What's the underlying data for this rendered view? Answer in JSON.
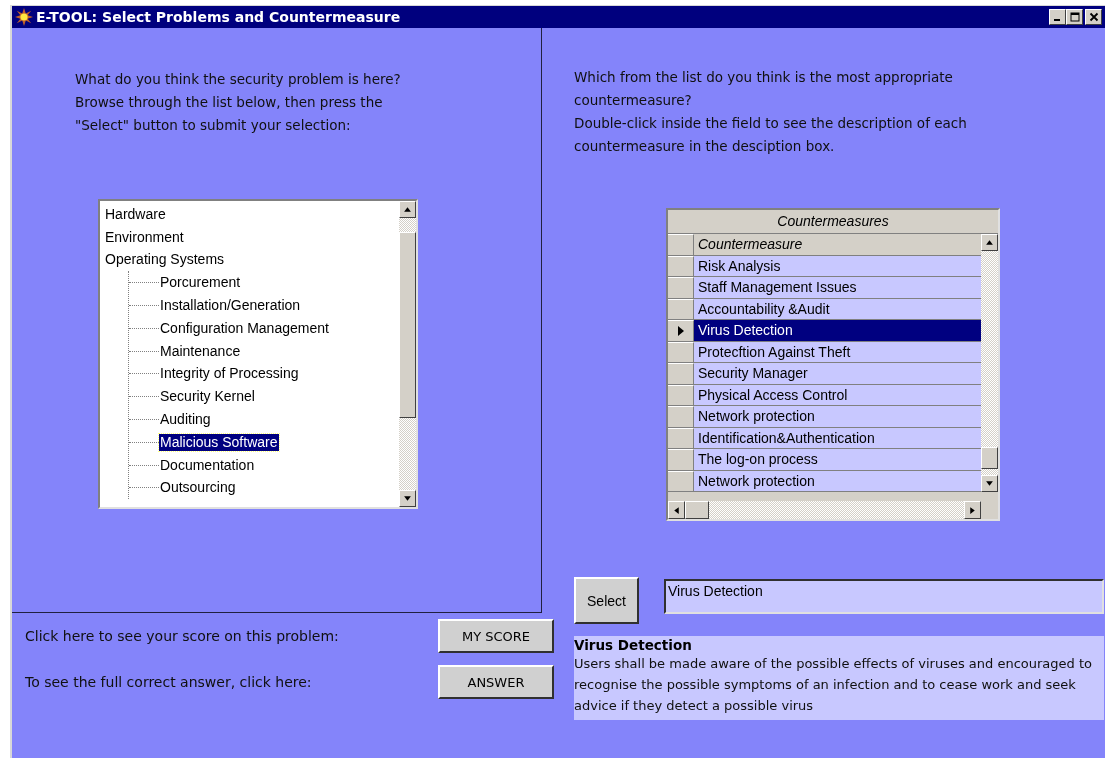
{
  "window": {
    "title": "E-TOOL: Select Problems and Countermeasure"
  },
  "problem_intro": {
    "lines": [
      "What do you think the security problem is here?",
      "Browse through the list below, then press the",
      "\"Select\" button to submit your selection:"
    ]
  },
  "problem_tree": [
    {
      "label": "Hardware",
      "selected": false
    },
    {
      "label": "Environment",
      "selected": false
    },
    {
      "label": "Operating Systems",
      "selected": false,
      "children": [
        {
          "label": "Porcurement",
          "selected": false
        },
        {
          "label": "Installation/Generation",
          "selected": false
        },
        {
          "label": "Configuration Management",
          "selected": false
        },
        {
          "label": "Maintenance",
          "selected": false
        },
        {
          "label": "Integrity of Processing",
          "selected": false
        },
        {
          "label": "Security Kernel",
          "selected": false
        },
        {
          "label": "Auditing",
          "selected": false
        },
        {
          "label": "Malicious Software",
          "selected": true
        },
        {
          "label": "Documentation",
          "selected": false
        },
        {
          "label": "Outsourcing",
          "selected": false
        }
      ]
    }
  ],
  "score_prompt": "Click here to see  your score on this problem:",
  "score_button": "MY SCORE",
  "answer_prompt": "To see the full correct answer, click here:",
  "answer_button": "ANSWER",
  "countermeasure_intro": {
    "lines": [
      "Which from the list do you think is the most appropriate",
      "countermeasure?",
      "Double-click inside the field to see the description of each",
      "countermeasure in the desciption box."
    ]
  },
  "grid": {
    "title": "Countermeasures",
    "column": "Countermeasure",
    "rows": [
      {
        "name": "Risk Analysis",
        "selected": false
      },
      {
        "name": "Staff Management Issues",
        "selected": false
      },
      {
        "name": "Accountability &Audit",
        "selected": false
      },
      {
        "name": "Virus Detection",
        "selected": true
      },
      {
        "name": "Protecftion Against Theft",
        "selected": false
      },
      {
        "name": "Security Manager",
        "selected": false
      },
      {
        "name": "Physical Access Control",
        "selected": false
      },
      {
        "name": "Network protection",
        "selected": false
      },
      {
        "name": "Identification&Authentication",
        "selected": false
      },
      {
        "name": "The log-on process",
        "selected": false
      },
      {
        "name": "Network protection",
        "selected": false
      }
    ]
  },
  "select_button": "Select",
  "selection_field": {
    "value": "Virus Detection"
  },
  "description": {
    "title": "Virus Detection",
    "text": "Users shall be made aware of the possible effects of viruses and encouraged to recognise the possible symptoms of an infection and to cease work and seek advice if they detect a possible virus"
  }
}
